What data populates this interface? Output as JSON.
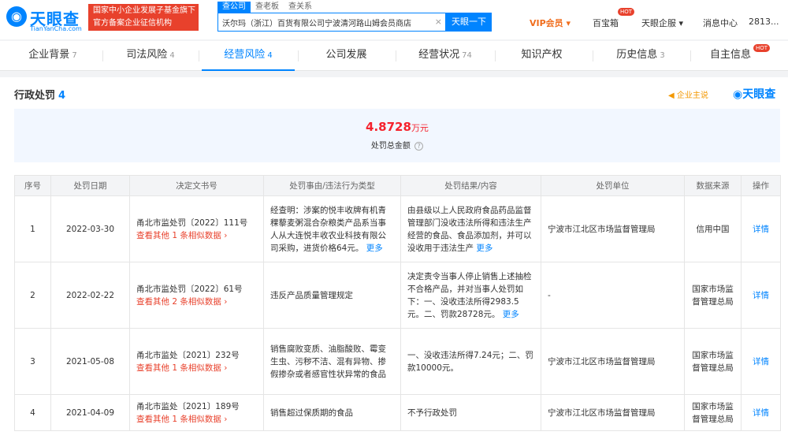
{
  "header": {
    "logo_name": "天眼查",
    "logo_sub": "TianYanCha.com",
    "badge_line1": "国家中小企业发展子基金旗下",
    "badge_line2": "官方备案企业征信机构",
    "search_tabs": [
      "查公司",
      "查老板",
      "查关系"
    ],
    "search_value": "沃尔玛（浙江）百货有限公司宁波清河路山姆会员商店",
    "search_button": "天眼一下",
    "vip": "VIP会员",
    "baobaoxiang": "百宝箱",
    "hot": "HOT",
    "enterprise": "天眼企服",
    "messages": "消息中心",
    "user": "2813..."
  },
  "tabs": [
    {
      "label": "企业背景",
      "count": "7"
    },
    {
      "label": "司法风险",
      "count": "4"
    },
    {
      "label": "经营风险",
      "count": "4"
    },
    {
      "label": "公司发展",
      "count": ""
    },
    {
      "label": "经营状况",
      "count": "74"
    },
    {
      "label": "知识产权",
      "count": ""
    },
    {
      "label": "历史信息",
      "count": "3"
    },
    {
      "label": "自主信息",
      "count": ""
    }
  ],
  "section": {
    "title": "行政处罚",
    "count": "4",
    "ad_label": "企业主说",
    "watermark": "天眼查",
    "total_amount": "4.8728",
    "total_unit": "万元",
    "total_label": "处罚总金额",
    "help": "?"
  },
  "table": {
    "headers": [
      "序号",
      "处罚日期",
      "决定文书号",
      "处罚事由/违法行为类型",
      "处罚结果/内容",
      "处罚单位",
      "数据来源",
      "操作"
    ],
    "rows": [
      {
        "no": "1",
        "date": "2022-03-30",
        "doc": "甬北市监处罚〔2022〕111号",
        "similar": "查看其他 1 条相似数据",
        "reason": "经查明：涉案的悦丰收牌有机青稞藜麦粥混合杂粮类产品系当事人从大连悦丰收农业科技有限公司采购，进货价格64元。",
        "reason_more": "更多",
        "result": "由县级以上人民政府食品药品监督管理部门没收违法所得和违法生产经营的食品、食品添加剂，并可以没收用于违法生产",
        "result_more": "更多",
        "unit": "宁波市江北区市场监督管理局",
        "source": "信用中国",
        "action": "详情"
      },
      {
        "no": "2",
        "date": "2022-02-22",
        "doc": "甬北市监处罚〔2022〕61号",
        "similar": "查看其他 2 条相似数据",
        "reason": "违反产品质量管理规定",
        "reason_more": "",
        "result": "决定责令当事人停止销售上述抽检不合格产品，并对当事人处罚如下：一、没收违法所得2983.5元。二、罚款28728元。",
        "result_more": "更多",
        "unit": "-",
        "source": "国家市场监督管理总局",
        "action": "详情"
      },
      {
        "no": "3",
        "date": "2021-05-08",
        "doc": "甬北市监处〔2021〕232号",
        "similar": "查看其他 1 条相似数据",
        "reason": "销售腐败变质、油脂酸败、霉变生虫、污秽不洁、混有异物、掺假掺杂或者感官性状异常的食品",
        "reason_more": "",
        "result": "一、没收违法所得7.24元；二、罚款10000元。",
        "result_more": "",
        "unit": "宁波市江北区市场监督管理局",
        "source": "国家市场监督管理总局",
        "action": "详情"
      },
      {
        "no": "4",
        "date": "2021-04-09",
        "doc": "甬北市监处〔2021〕189号",
        "similar": "查看其他 1 条相似数据",
        "reason": "销售超过保质期的食品",
        "reason_more": "",
        "result": "不予行政处罚",
        "result_more": "",
        "unit": "宁波市江北区市场监督管理局",
        "source": "国家市场监督管理总局",
        "action": "详情"
      }
    ]
  }
}
